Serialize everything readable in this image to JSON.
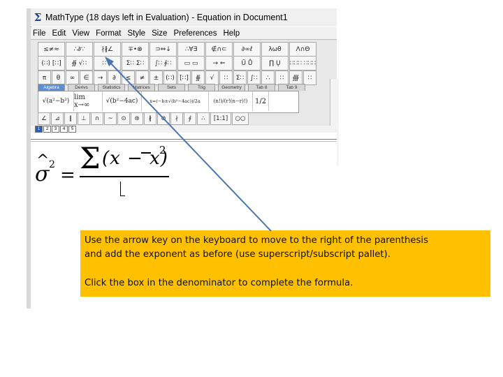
{
  "window": {
    "title": "MathType (18 days left in Evaluation) - Equation in Document1",
    "app_icon": "sigma-icon"
  },
  "menu": [
    "File",
    "Edit",
    "View",
    "Format",
    "Style",
    "Size",
    "Preferences",
    "Help"
  ],
  "palette_rows": [
    [
      "≤≠≈",
      "∴∂∵",
      "∤∦∠",
      "∓•⊗",
      "⊃⇔↓",
      "∴∀∃",
      "∉∩⊂",
      "∂∞ℓ",
      "λωθ",
      "Λ∩Θ"
    ],
    [
      "(∷) [∷]",
      "∯ √∷",
      "∷ ∷",
      "Σ∷ Σ∷",
      "∫∷ ∮∷",
      "▭ ▭",
      "→ ⇐",
      "Ū Ů",
      "∏ Ų",
      "∷∷∷ ∷∷∷"
    ],
    [
      "π",
      "θ",
      "∞",
      "∈",
      "→",
      "∂",
      "≤",
      "≠",
      "±",
      "(∷)",
      "[∷]",
      "∯",
      "√",
      "∷",
      "Σ∷",
      "∫∷",
      "∴",
      "∷",
      "∰",
      "∷"
    ]
  ],
  "template_tabs": [
    "Algebra",
    "Derivs",
    "Statistics",
    "Matrices",
    "Sets",
    "Trig",
    "Geometry",
    "Tab 8",
    "Tab 9"
  ],
  "template_items": [
    "√(a²−b²)",
    "lim x→∞",
    "√(b²−4ac)",
    "x=(−b±√(b²−4ac))/2a",
    "(n!)/(r!(n−r)!)",
    "1/2"
  ],
  "bottom_row": [
    "∠",
    "⊿",
    "∥",
    "⊥",
    "∩",
    "~",
    "⊙",
    "⊛",
    "∦",
    "⊗",
    "∤",
    "∮",
    "∴",
    "[1:1]",
    "○○"
  ],
  "size_tabs": [
    "1",
    "2",
    "3",
    "4",
    "5"
  ],
  "formula": {
    "lhs": "σ",
    "hat": "^",
    "lhs_exp": "2",
    "equals": "=",
    "sum": "Σ",
    "numerator": "(x − x)",
    "num_exp": "2"
  },
  "callout": {
    "text": "Use the arrow key on the keyboard to move to the  right of the parenthesis\nand add the exponent as before (use superscript/subscript pallet).",
    "text2": "Click the box in the denominator to complete the formula.",
    "color": "#ffc000"
  },
  "arrow_color": "#4a76b0"
}
